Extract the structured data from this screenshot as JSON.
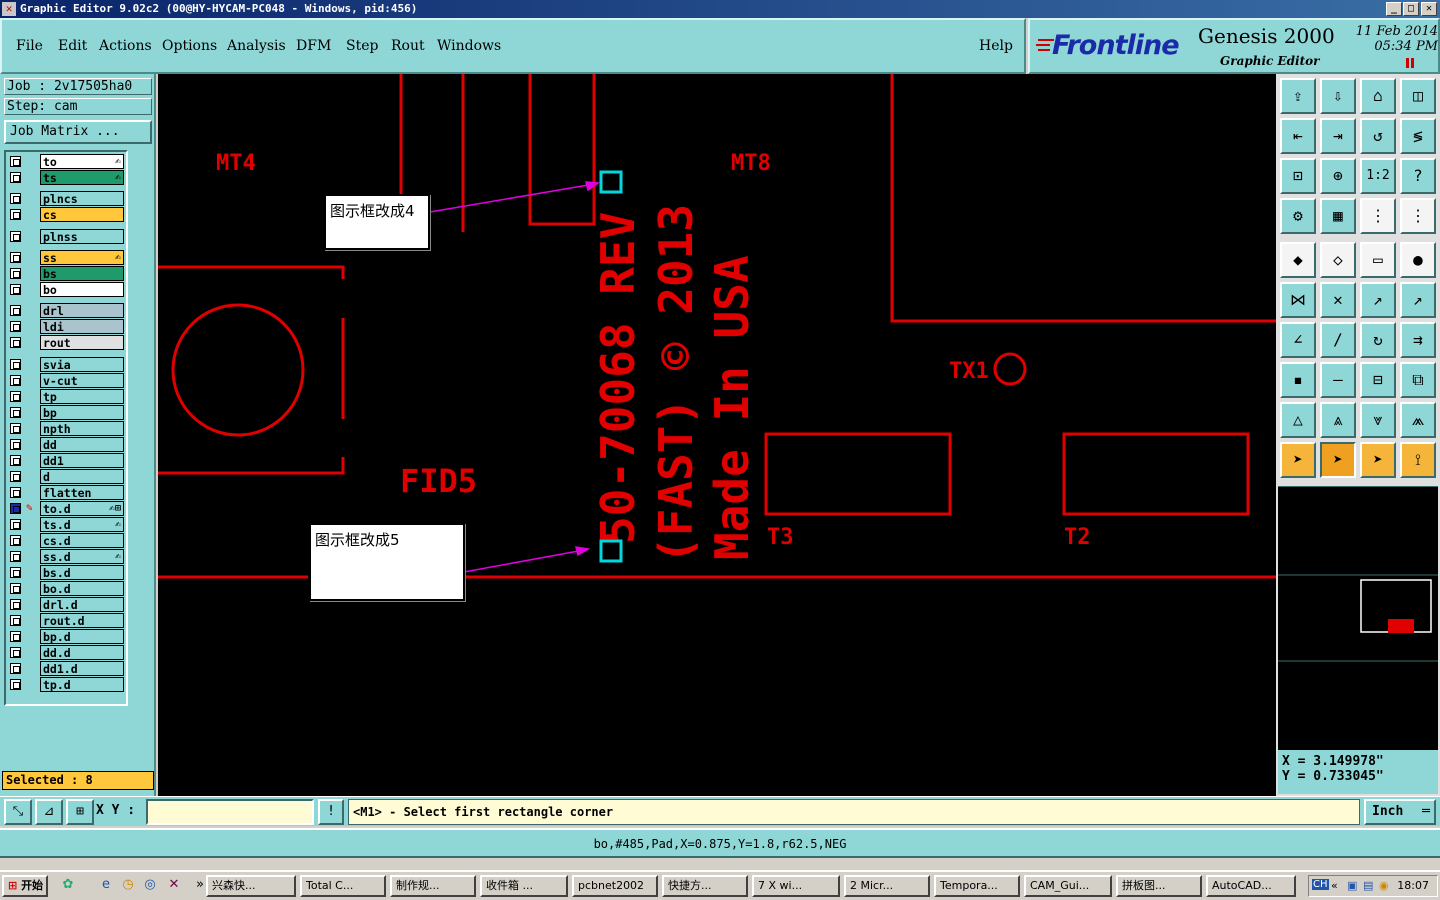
{
  "window": {
    "title": "Graphic Editor 9.02c2  (00@HY-HYCAM-PC048 - Windows, pid:456)"
  },
  "menu": {
    "items": [
      "File",
      "Edit",
      "Actions",
      "Options",
      "Analysis",
      "DFM",
      "Step",
      "Rout",
      "Windows"
    ],
    "help": "Help"
  },
  "brand": {
    "logo": "Frontline",
    "product": "Genesis 2000",
    "subtitle": "Graphic Editor",
    "date": "11 Feb 2014",
    "time": "05:34 PM"
  },
  "job": {
    "job_line": "Job : 2v17505ha0",
    "step_line": "Step: cam",
    "matrix_button": "Job Matrix ..."
  },
  "layers": [
    {
      "name": "to",
      "color": "#ffffff",
      "mark": "✍"
    },
    {
      "name": "ts",
      "color": "#1f9a6a",
      "mark": "✍"
    },
    {
      "name": "plncs",
      "color": "#8fd6d6",
      "mark": ""
    },
    {
      "name": "cs",
      "color": "#ffc73b",
      "mark": ""
    },
    {
      "name": "plnss",
      "color": "#8fd6d6",
      "mark": ""
    },
    {
      "name": "ss",
      "color": "#ffc73b",
      "mark": "✍"
    },
    {
      "name": "bs",
      "color": "#1f9a6a",
      "mark": ""
    },
    {
      "name": "bo",
      "color": "#ffffff",
      "mark": ""
    },
    {
      "name": "drl",
      "color": "#a9c4cc",
      "mark": ""
    },
    {
      "name": "ldi",
      "color": "#a9c4cc",
      "mark": ""
    },
    {
      "name": "rout",
      "color": "#e0e0e0",
      "mark": ""
    },
    {
      "name": "svia",
      "color": "#8fd6d6",
      "mark": ""
    },
    {
      "name": "v-cut",
      "color": "#8fd6d6",
      "mark": ""
    },
    {
      "name": "tp",
      "color": "#8fd6d6",
      "mark": ""
    },
    {
      "name": "bp",
      "color": "#8fd6d6",
      "mark": ""
    },
    {
      "name": "npth",
      "color": "#8fd6d6",
      "mark": ""
    },
    {
      "name": "dd",
      "color": "#8fd6d6",
      "mark": ""
    },
    {
      "name": "dd1",
      "color": "#8fd6d6",
      "mark": ""
    },
    {
      "name": "d",
      "color": "#8fd6d6",
      "mark": ""
    },
    {
      "name": "flatten",
      "color": "#8fd6d6",
      "mark": ""
    },
    {
      "name": "to.d",
      "color": "#8fd6d6",
      "mark": "✍⊞"
    },
    {
      "name": "ts.d",
      "color": "#8fd6d6",
      "mark": "✍"
    },
    {
      "name": "cs.d",
      "color": "#8fd6d6",
      "mark": ""
    },
    {
      "name": "ss.d",
      "color": "#8fd6d6",
      "mark": "✍"
    },
    {
      "name": "bs.d",
      "color": "#8fd6d6",
      "mark": ""
    },
    {
      "name": "bo.d",
      "color": "#8fd6d6",
      "mark": ""
    },
    {
      "name": "drl.d",
      "color": "#8fd6d6",
      "mark": ""
    },
    {
      "name": "rout.d",
      "color": "#8fd6d6",
      "mark": ""
    },
    {
      "name": "bp.d",
      "color": "#8fd6d6",
      "mark": ""
    },
    {
      "name": "dd.d",
      "color": "#8fd6d6",
      "mark": ""
    },
    {
      "name": "dd1.d",
      "color": "#8fd6d6",
      "mark": ""
    },
    {
      "name": "tp.d",
      "color": "#8fd6d6",
      "mark": ""
    }
  ],
  "selected_text": "Selected : 8",
  "canvas": {
    "labels": {
      "mt4": "MT4",
      "mt8": "MT8",
      "fid5": "FID5",
      "tx1": "TX1",
      "t3": "T3",
      "t2": "T2",
      "line1": "50-70068 REV",
      "line2": "(FAST) © 2013",
      "line3": "Made In USA"
    },
    "callouts": {
      "c4": "图示框改成4",
      "c5": "图示框改成5"
    }
  },
  "coords": {
    "x": "X  =  3.149978\"",
    "y": "Y  =  0.733045\""
  },
  "command": {
    "xy_label": "X Y :",
    "xy_value": "",
    "prompt": "<M1> - Select first rectangle corner",
    "unit": "Inch"
  },
  "status": "bo,#485,Pad,X=0.875,Y=1.8,r62.5,NEG",
  "taskbar": {
    "start": "开始",
    "items": [
      "兴森快...",
      "Total C...",
      "制作规...",
      "收件箱 ...",
      "pcbnet2002",
      "快捷方...",
      "7 X wi...",
      "2 Micr...",
      "Tempora...",
      "CAM_Gui...",
      "拼板图...",
      "AutoCAD..."
    ],
    "tray_prefix": "CH",
    "clock": "18:07"
  }
}
